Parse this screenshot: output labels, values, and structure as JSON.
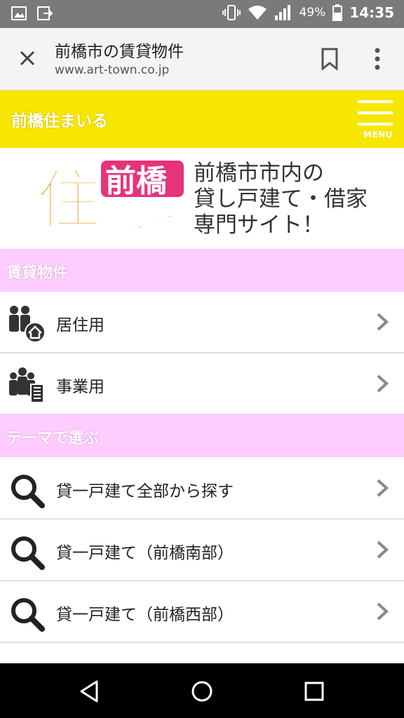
{
  "status_bar": {
    "battery_percent": "49%",
    "time": "14:35",
    "icons": [
      "gallery-icon",
      "cast-icon",
      "vibrate-icon",
      "wifi-icon",
      "signal-icon",
      "battery-icon"
    ]
  },
  "browser": {
    "title": "前橋市の賃貸物件",
    "url": "www.art-town.co.jp",
    "icons": [
      "close-icon",
      "bookmark-icon",
      "more-vert-icon"
    ]
  },
  "site_header": {
    "title": "前橋住まいる",
    "menu_label": "MENU"
  },
  "banner": {
    "logo_text": "住前橋まいる",
    "tagline": [
      "前橋市市内の",
      "貸し戸建て・借家",
      "専門サイト！"
    ]
  },
  "sections": [
    {
      "title": "賃貸物件",
      "items": [
        {
          "label": "居住用",
          "icon": "people-home-icon"
        },
        {
          "label": "事業用",
          "icon": "people-building-icon"
        }
      ]
    },
    {
      "title": "テーマで選ぶ",
      "items": [
        {
          "label": "貸一戸建て全部から探す",
          "icon": "search-icon"
        },
        {
          "label": "貸一戸建て（前橋南部）",
          "icon": "search-icon"
        },
        {
          "label": "貸一戸建て（前橋西部）",
          "icon": "search-icon"
        }
      ]
    }
  ],
  "colors": {
    "header_yellow": "#f7e600",
    "section_pink": "#ffccff",
    "status_gray": "#7a7a7a"
  },
  "nav_bar": {
    "icons": [
      "back-icon",
      "home-icon",
      "recents-icon"
    ]
  }
}
